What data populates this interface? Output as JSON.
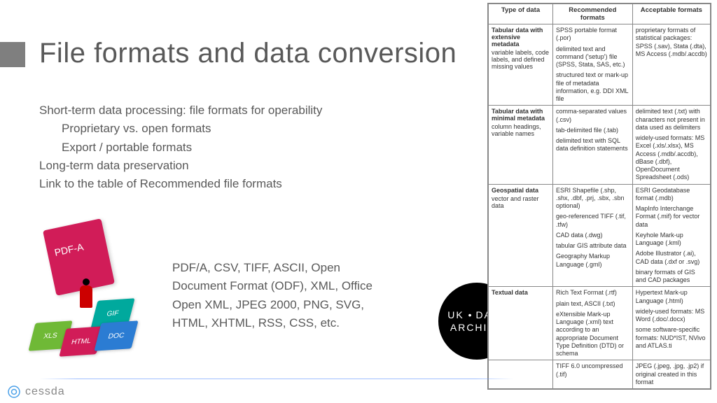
{
  "title": "File formats and data conversion",
  "bullets": {
    "line1": "Short-term data processing: file formats for operability",
    "line1a": "Proprietary vs. open formats",
    "line1b": "Export / portable formats",
    "line2": "Long-term data preservation",
    "line3": "Link to the table of Recommended file formats"
  },
  "formats_paragraph": "PDF/A, CSV, TIFF, ASCII, Open Document  Format (ODF), XML, Office Open XML, JPEG 2000, PNG,  SVG, HTML, XHTML, RSS, CSS, etc.",
  "illustration": {
    "pdfa_label": "PDF-A",
    "tiles": {
      "xls": "XLS",
      "html": "HTML",
      "doc": "DOC",
      "gif": "GIF"
    }
  },
  "ukda": {
    "line1": "UK",
    "dot": "•",
    "line1b": "DATA",
    "line2": "ARCHIVE"
  },
  "table": {
    "headers": [
      "Type of data",
      "Recommended formats",
      "Acceptable formats"
    ],
    "rows": [
      {
        "type_bold": "Tabular data with extensive metadata",
        "type_note": "variable labels, code labels, and defined missing values",
        "rec": [
          "SPSS portable format (.por)",
          "delimited text and command ('setup') file (SPSS, Stata, SAS, etc.)",
          "structured text or mark-up file of metadata information, e.g. DDI XML file"
        ],
        "acc": [
          "proprietary formats of statistical packages: SPSS (.sav), Stata (.dta), MS Access (.mdb/.accdb)"
        ]
      },
      {
        "type_bold": "Tabular data with minimal metadata",
        "type_note": "column headings, variable names",
        "rec": [
          "comma-separated values (.csv)",
          "tab-delimited file (.tab)",
          "delimited text with SQL data definition statements"
        ],
        "acc": [
          "delimited text (.txt) with characters not present in data used as delimiters",
          "widely-used formats: MS Excel (.xls/.xlsx), MS Access (.mdb/.accdb), dBase (.dbf), OpenDocument Spreadsheet (.ods)"
        ]
      },
      {
        "type_bold": "Geospatial data",
        "type_note": "vector and raster data",
        "rec": [
          "ESRI Shapefile (.shp, .shx, .dbf, .prj, .sbx, .sbn optional)",
          "geo-referenced TIFF (.tif, .tfw)",
          "CAD data (.dwg)",
          "tabular GIS attribute data",
          "Geography Markup Language (.gml)"
        ],
        "acc": [
          "ESRI Geodatabase format (.mdb)",
          "MapInfo Interchange Format (.mif) for vector data",
          "Keyhole Mark-up Language (.kml)",
          "Adobe Illustrator (.ai), CAD data (.dxf or .svg)",
          "binary formats of GIS and CAD packages"
        ]
      },
      {
        "type_bold": "Textual data",
        "type_note": "",
        "rec": [
          "Rich Text Format (.rtf)",
          "plain text, ASCII (.txt)",
          "eXtensible Mark-up Language (.xml) text according to an appropriate Document Type Definition (DTD) or schema"
        ],
        "acc": [
          "Hypertext Mark-up Language (.html)",
          "widely-used formats: MS Word (.doc/.docx)",
          "some software-specific formats: NUD*IST, NVivo and ATLAS.ti"
        ]
      },
      {
        "type_bold": "",
        "type_note": "",
        "rec": [
          "TIFF 6.0 uncompressed (.tif)"
        ],
        "acc": [
          "JPEG (.jpeg, .jpg, .jp2) if original created in this format"
        ]
      }
    ]
  },
  "footer": {
    "brand": "cessda"
  }
}
